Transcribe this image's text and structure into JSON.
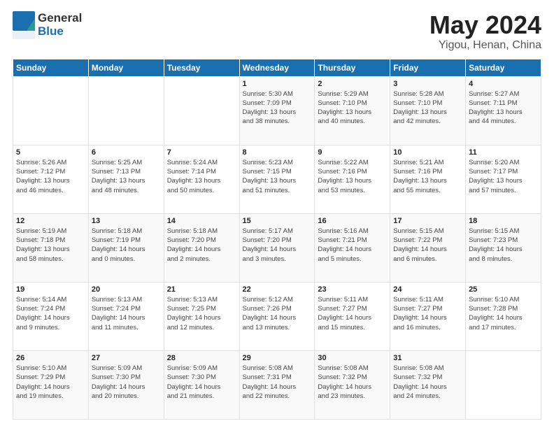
{
  "header": {
    "logo_general": "General",
    "logo_blue": "Blue",
    "month": "May 2024",
    "location": "Yigou, Henan, China"
  },
  "days_of_week": [
    "Sunday",
    "Monday",
    "Tuesday",
    "Wednesday",
    "Thursday",
    "Friday",
    "Saturday"
  ],
  "weeks": [
    [
      {
        "day": "",
        "info": ""
      },
      {
        "day": "",
        "info": ""
      },
      {
        "day": "",
        "info": ""
      },
      {
        "day": "1",
        "info": "Sunrise: 5:30 AM\nSunset: 7:09 PM\nDaylight: 13 hours\nand 38 minutes."
      },
      {
        "day": "2",
        "info": "Sunrise: 5:29 AM\nSunset: 7:10 PM\nDaylight: 13 hours\nand 40 minutes."
      },
      {
        "day": "3",
        "info": "Sunrise: 5:28 AM\nSunset: 7:10 PM\nDaylight: 13 hours\nand 42 minutes."
      },
      {
        "day": "4",
        "info": "Sunrise: 5:27 AM\nSunset: 7:11 PM\nDaylight: 13 hours\nand 44 minutes."
      }
    ],
    [
      {
        "day": "5",
        "info": "Sunrise: 5:26 AM\nSunset: 7:12 PM\nDaylight: 13 hours\nand 46 minutes."
      },
      {
        "day": "6",
        "info": "Sunrise: 5:25 AM\nSunset: 7:13 PM\nDaylight: 13 hours\nand 48 minutes."
      },
      {
        "day": "7",
        "info": "Sunrise: 5:24 AM\nSunset: 7:14 PM\nDaylight: 13 hours\nand 50 minutes."
      },
      {
        "day": "8",
        "info": "Sunrise: 5:23 AM\nSunset: 7:15 PM\nDaylight: 13 hours\nand 51 minutes."
      },
      {
        "day": "9",
        "info": "Sunrise: 5:22 AM\nSunset: 7:16 PM\nDaylight: 13 hours\nand 53 minutes."
      },
      {
        "day": "10",
        "info": "Sunrise: 5:21 AM\nSunset: 7:16 PM\nDaylight: 13 hours\nand 55 minutes."
      },
      {
        "day": "11",
        "info": "Sunrise: 5:20 AM\nSunset: 7:17 PM\nDaylight: 13 hours\nand 57 minutes."
      }
    ],
    [
      {
        "day": "12",
        "info": "Sunrise: 5:19 AM\nSunset: 7:18 PM\nDaylight: 13 hours\nand 58 minutes."
      },
      {
        "day": "13",
        "info": "Sunrise: 5:18 AM\nSunset: 7:19 PM\nDaylight: 14 hours\nand 0 minutes."
      },
      {
        "day": "14",
        "info": "Sunrise: 5:18 AM\nSunset: 7:20 PM\nDaylight: 14 hours\nand 2 minutes."
      },
      {
        "day": "15",
        "info": "Sunrise: 5:17 AM\nSunset: 7:20 PM\nDaylight: 14 hours\nand 3 minutes."
      },
      {
        "day": "16",
        "info": "Sunrise: 5:16 AM\nSunset: 7:21 PM\nDaylight: 14 hours\nand 5 minutes."
      },
      {
        "day": "17",
        "info": "Sunrise: 5:15 AM\nSunset: 7:22 PM\nDaylight: 14 hours\nand 6 minutes."
      },
      {
        "day": "18",
        "info": "Sunrise: 5:15 AM\nSunset: 7:23 PM\nDaylight: 14 hours\nand 8 minutes."
      }
    ],
    [
      {
        "day": "19",
        "info": "Sunrise: 5:14 AM\nSunset: 7:24 PM\nDaylight: 14 hours\nand 9 minutes."
      },
      {
        "day": "20",
        "info": "Sunrise: 5:13 AM\nSunset: 7:24 PM\nDaylight: 14 hours\nand 11 minutes."
      },
      {
        "day": "21",
        "info": "Sunrise: 5:13 AM\nSunset: 7:25 PM\nDaylight: 14 hours\nand 12 minutes."
      },
      {
        "day": "22",
        "info": "Sunrise: 5:12 AM\nSunset: 7:26 PM\nDaylight: 14 hours\nand 13 minutes."
      },
      {
        "day": "23",
        "info": "Sunrise: 5:11 AM\nSunset: 7:27 PM\nDaylight: 14 hours\nand 15 minutes."
      },
      {
        "day": "24",
        "info": "Sunrise: 5:11 AM\nSunset: 7:27 PM\nDaylight: 14 hours\nand 16 minutes."
      },
      {
        "day": "25",
        "info": "Sunrise: 5:10 AM\nSunset: 7:28 PM\nDaylight: 14 hours\nand 17 minutes."
      }
    ],
    [
      {
        "day": "26",
        "info": "Sunrise: 5:10 AM\nSunset: 7:29 PM\nDaylight: 14 hours\nand 19 minutes."
      },
      {
        "day": "27",
        "info": "Sunrise: 5:09 AM\nSunset: 7:30 PM\nDaylight: 14 hours\nand 20 minutes."
      },
      {
        "day": "28",
        "info": "Sunrise: 5:09 AM\nSunset: 7:30 PM\nDaylight: 14 hours\nand 21 minutes."
      },
      {
        "day": "29",
        "info": "Sunrise: 5:08 AM\nSunset: 7:31 PM\nDaylight: 14 hours\nand 22 minutes."
      },
      {
        "day": "30",
        "info": "Sunrise: 5:08 AM\nSunset: 7:32 PM\nDaylight: 14 hours\nand 23 minutes."
      },
      {
        "day": "31",
        "info": "Sunrise: 5:08 AM\nSunset: 7:32 PM\nDaylight: 14 hours\nand 24 minutes."
      },
      {
        "day": "",
        "info": ""
      }
    ]
  ]
}
